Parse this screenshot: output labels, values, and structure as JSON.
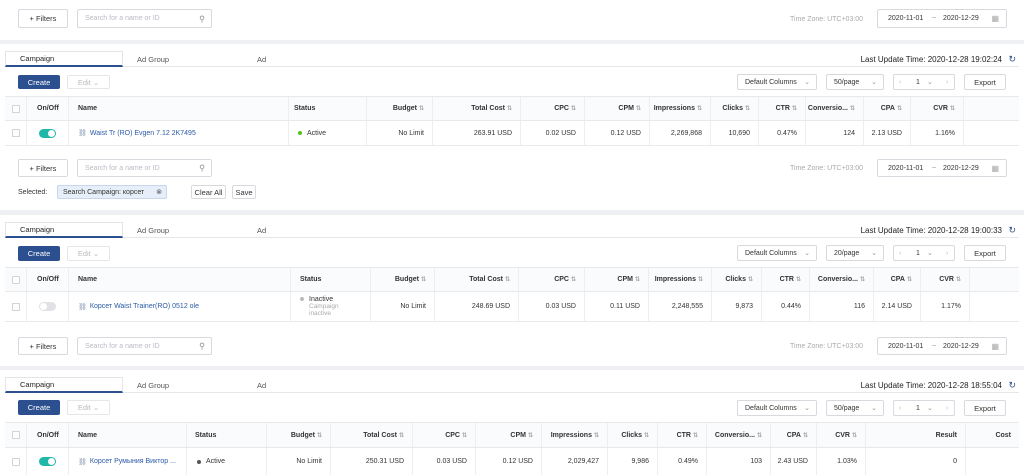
{
  "colors": {
    "accent": "#2b4f8f",
    "toggle_on": "#1fb8a8",
    "active": "#52c41a",
    "inactive": "#bbbbbb"
  },
  "filters_label": "+ Filters",
  "search_placeholder": "Search for a name or ID",
  "timezone_label": "Time Zone: UTC+03:00",
  "date_start": "2020-11-01",
  "date_sep": "~",
  "date_end": "2020-12-29",
  "tabs": {
    "campaign": "Campaign",
    "adgroup": "Ad Group",
    "ad": "Ad"
  },
  "toolbar": {
    "create": "Create",
    "edit": "Edit",
    "default_columns": "Default Columns",
    "page_size_50": "50/page",
    "page_size_20": "20/page",
    "page_number": "1",
    "export": "Export"
  },
  "selected": {
    "label": "Selected:",
    "chip": "Search Campaign: корсет",
    "clear_all": "Clear All",
    "save": "Save"
  },
  "headers": {
    "onoff": "On/Off",
    "name": "Name",
    "status": "Status",
    "budget": "Budget",
    "total_cost": "Total Cost",
    "cpc": "CPC",
    "cpm": "CPM",
    "impressions": "Impressions",
    "clicks": "Clicks",
    "ctr": "CTR",
    "conversions": "Conversio...",
    "cpa": "CPA",
    "cvr": "CVR",
    "result": "Result",
    "cost": "Cost"
  },
  "sections": [
    {
      "last_update": "Last Update Time: 2020-12-28 19:02:24",
      "row": {
        "name": "Waist Tr (RO) Evgen 7.12 2K7495",
        "status": "Active",
        "budget": "No Limit",
        "total_cost": "263.91 USD",
        "cpc": "0.02 USD",
        "cpm": "0.12 USD",
        "impressions": "2,269,868",
        "clicks": "10,690",
        "ctr": "0.47%",
        "conversions": "124",
        "cpa": "2.13 USD",
        "cvr": "1.16%"
      }
    },
    {
      "last_update": "Last Update Time: 2020-12-28 19:00:33",
      "row": {
        "name": "Корсет Waist Trainer(RO) 0512 ole",
        "status": "Inactive",
        "status_sub1": "Campaign",
        "status_sub2": "inactive",
        "budget": "No Limit",
        "total_cost": "248.69 USD",
        "cpc": "0.03 USD",
        "cpm": "0.11 USD",
        "impressions": "2,248,555",
        "clicks": "9,873",
        "ctr": "0.44%",
        "conversions": "116",
        "cpa": "2.14 USD",
        "cvr": "1.17%"
      }
    },
    {
      "last_update": "Last Update Time: 2020-12-28 18:55:04",
      "row": {
        "name": "Корсет Румыния Виктор ...",
        "status": "Active",
        "budget": "No Limit",
        "total_cost": "250.31 USD",
        "cpc": "0.03 USD",
        "cpm": "0.12 USD",
        "impressions": "2,029,427",
        "clicks": "9,986",
        "ctr": "0.49%",
        "conversions": "103",
        "cpa": "2.43 USD",
        "cvr": "1.03%",
        "result": "0"
      }
    }
  ]
}
